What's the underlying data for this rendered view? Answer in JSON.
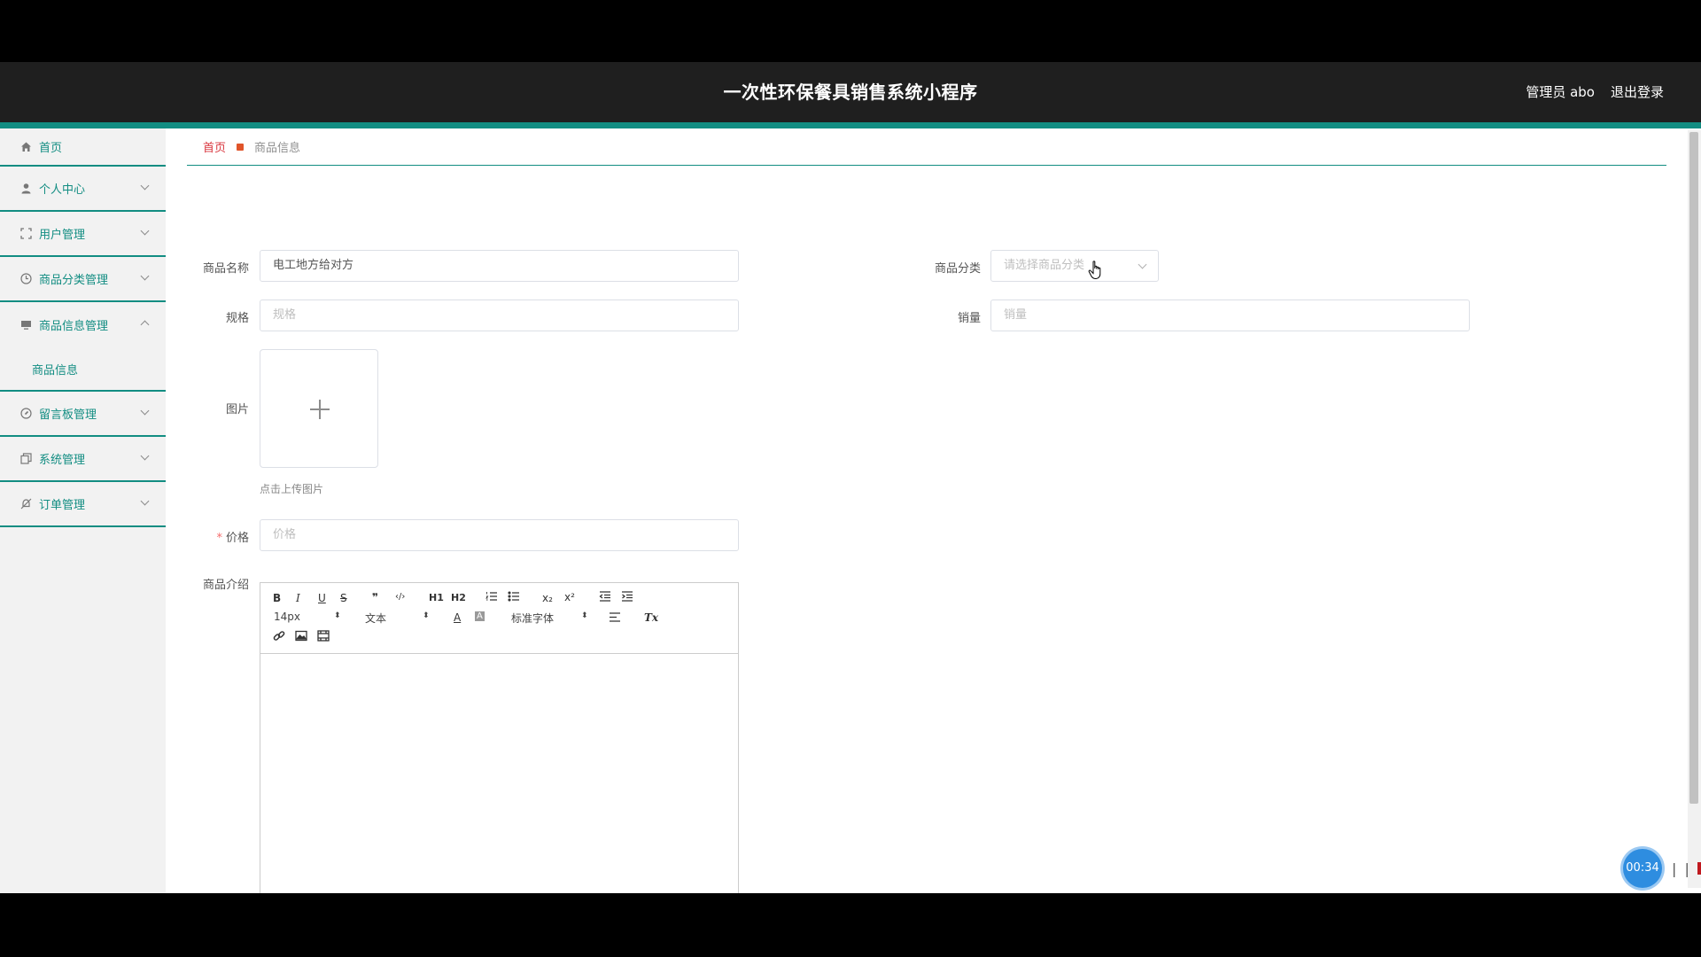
{
  "header": {
    "title": "一次性环保餐具销售系统小程序",
    "user": "管理员 abo",
    "logout": "退出登录"
  },
  "sidebar": {
    "items": [
      {
        "label": "首页",
        "icon": "home-icon"
      },
      {
        "label": "个人中心",
        "icon": "user-icon"
      },
      {
        "label": "用户管理",
        "icon": "expand-icon"
      },
      {
        "label": "商品分类管理",
        "icon": "clock-icon"
      },
      {
        "label": "商品信息管理",
        "icon": "monitor-icon",
        "expanded": true,
        "sub": "商品信息"
      },
      {
        "label": "留言板管理",
        "icon": "compass-icon"
      },
      {
        "label": "系统管理",
        "icon": "copy-icon"
      },
      {
        "label": "订单管理",
        "icon": "bell-off-icon"
      }
    ]
  },
  "breadcrumb": {
    "home": "首页",
    "current": "商品信息"
  },
  "form": {
    "name_label": "商品名称",
    "name_value": "电工地方给对方",
    "category_label": "商品分类",
    "category_placeholder": "请选择商品分类",
    "spec_label": "规格",
    "spec_placeholder": "规格",
    "sales_label": "销量",
    "sales_placeholder": "销量",
    "image_label": "图片",
    "upload_hint": "点击上传图片",
    "price_required": "*",
    "price_label": "价格",
    "price_placeholder": "价格",
    "intro_label": "商品介绍"
  },
  "editor": {
    "font_size": "14px",
    "header_select": "文本",
    "font_family": "标准字体",
    "buttons": [
      "B",
      "I",
      "U",
      "S",
      "❞",
      "‹/›",
      "H1",
      "H2",
      "ordered-list",
      "bullet-list",
      "x₂",
      "x²",
      "outdent",
      "indent",
      "A",
      "A",
      "align",
      "Tx",
      "link",
      "image",
      "video"
    ]
  },
  "overlay": {
    "timer": "00:34",
    "pause": "| |"
  }
}
